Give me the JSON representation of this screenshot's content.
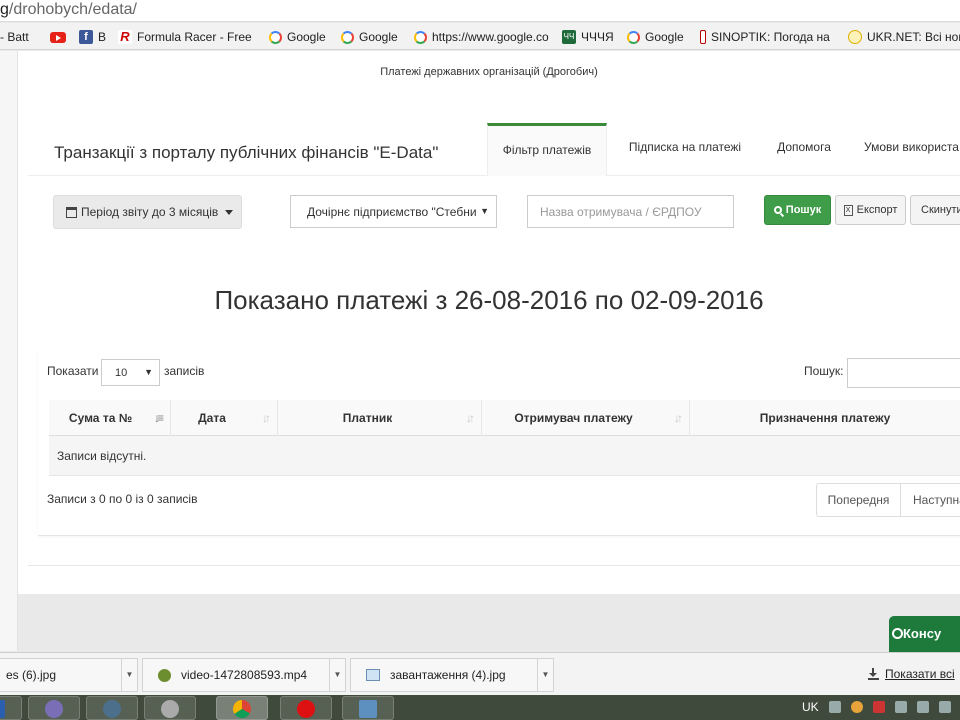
{
  "browser": {
    "url_dim": "g",
    "url_path": "/drohobych/edata/",
    "bookmarks": [
      {
        "icon": "generic-icon",
        "label": "- Batt"
      },
      {
        "icon": "youtube-icon",
        "label": ""
      },
      {
        "icon": "facebook-icon",
        "label": "B"
      },
      {
        "icon": "formula-racer-icon",
        "label": "Formula Racer - Free"
      },
      {
        "icon": "google-icon",
        "label": "Google"
      },
      {
        "icon": "google-icon",
        "label": "Google"
      },
      {
        "icon": "google-icon",
        "label": "https://www.google.co"
      },
      {
        "icon": "chchya-icon",
        "label": "ЧЧЧЯ"
      },
      {
        "icon": "google-icon",
        "label": "Google"
      },
      {
        "icon": "sinoptik-icon",
        "label": "SINOPTIK: Погода на"
      },
      {
        "icon": "ukrnet-icon",
        "label": "UKR.NET: Всі нов"
      }
    ]
  },
  "page": {
    "org_name": "Платежі державних організацій (Дрогобич)",
    "title": "Транзакції з порталу публічних фінансів \"E-Data\"",
    "tabs": [
      "Фільтр платежів",
      "Підписка на платежі",
      "Допомога",
      "Умови використа"
    ],
    "filters": {
      "period_label": "Період звіту до 3 місяців",
      "payer_select": "Дочірнє підприємство \"Стебни",
      "recipient_placeholder": "Назва отримувача / ЄРДПОУ",
      "search_button": "Пошук",
      "export_button": "Експорт",
      "reset_button": "Скинути"
    },
    "heading": "Показано платежі з 26-08-2016 по 02-09-2016",
    "table": {
      "show_label": "Показати",
      "page_length": "10",
      "records_label": "записів",
      "search_label": "Пошук:",
      "columns": [
        "Сума та №",
        "Дата",
        "Платник",
        "Отримувач платежу",
        "Призначення платежу"
      ],
      "empty_text": "Записи відсутні.",
      "info_text": "Записи з 0 по 0 із 0 записів",
      "prev_label": "Попередня",
      "next_label": "Наступна"
    },
    "consult_label": "Консу"
  },
  "downloads": {
    "items": [
      "es (6).jpg",
      "video-1472808593.mp4",
      "завантаження (4).jpg"
    ],
    "show_all": "Показати всі"
  },
  "tray": {
    "lang": "UK"
  }
}
